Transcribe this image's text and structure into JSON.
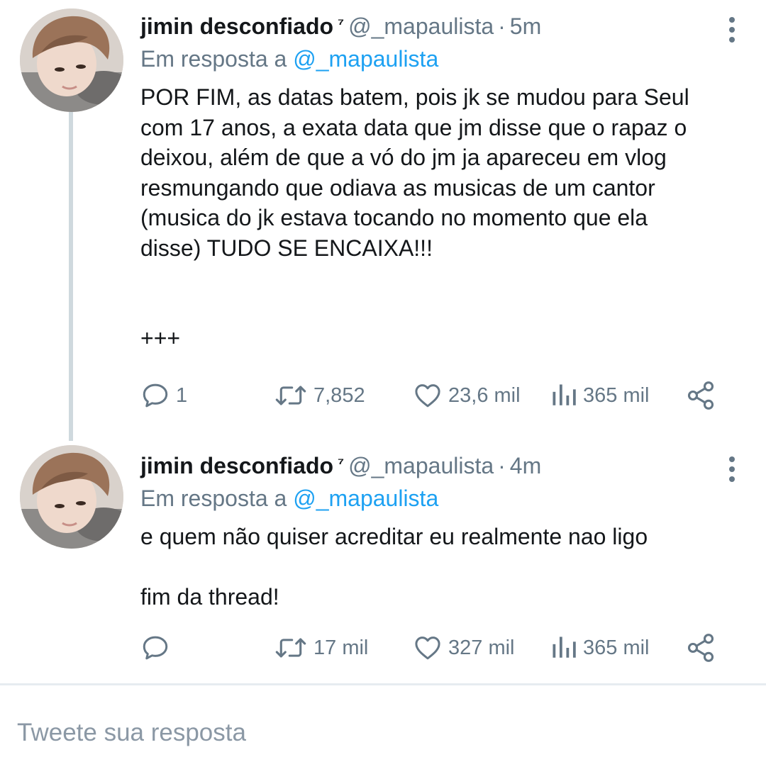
{
  "tweets": [
    {
      "display_name": "jimin desconfiado",
      "superscript": "⁷",
      "handle": "@_mapaulista",
      "separator": "·",
      "time": "5m",
      "reply_prefix": "Em resposta a",
      "reply_to": "@_mapaulista",
      "text": "POR FIM, as datas batem, pois jk se mudou para Seul\ncom 17 anos, a exata data que jm disse que o rapaz o\ndeixou, além de que a vó do jm ja apareceu em vlog\nresmungando que odiava as musicas de um cantor\n(musica do jk estava tocando no momento que ela\ndisse) TUDO SE ENCAIXA!!!\n\n\n+++",
      "replies": "1",
      "retweets": "7,852",
      "likes": "23,6 mil",
      "views": "365 mil"
    },
    {
      "display_name": "jimin desconfiado",
      "superscript": "⁷",
      "handle": "@_mapaulista",
      "separator": "·",
      "time": "4m",
      "reply_prefix": "Em resposta a",
      "reply_to": "@_mapaulista",
      "text": "e quem não quiser acreditar eu realmente nao ligo\n\nfim da thread!",
      "replies": "",
      "retweets": "17 mil",
      "likes": "327 mil",
      "views": "365 mil"
    }
  ],
  "composer": {
    "placeholder": "Tweete sua resposta"
  },
  "icons": {
    "reply": "speech-bubble-icon",
    "retweet": "retweet-arrows-icon",
    "like": "heart-icon",
    "views": "bar-chart-icon",
    "share": "share-nodes-icon",
    "more": "vertical-ellipsis-icon"
  },
  "colors": {
    "link": "#1da1f2",
    "secondary_text": "#657786",
    "primary_text": "#14171a",
    "thread_line": "#cfd9de",
    "divider": "#e6ecf0"
  }
}
